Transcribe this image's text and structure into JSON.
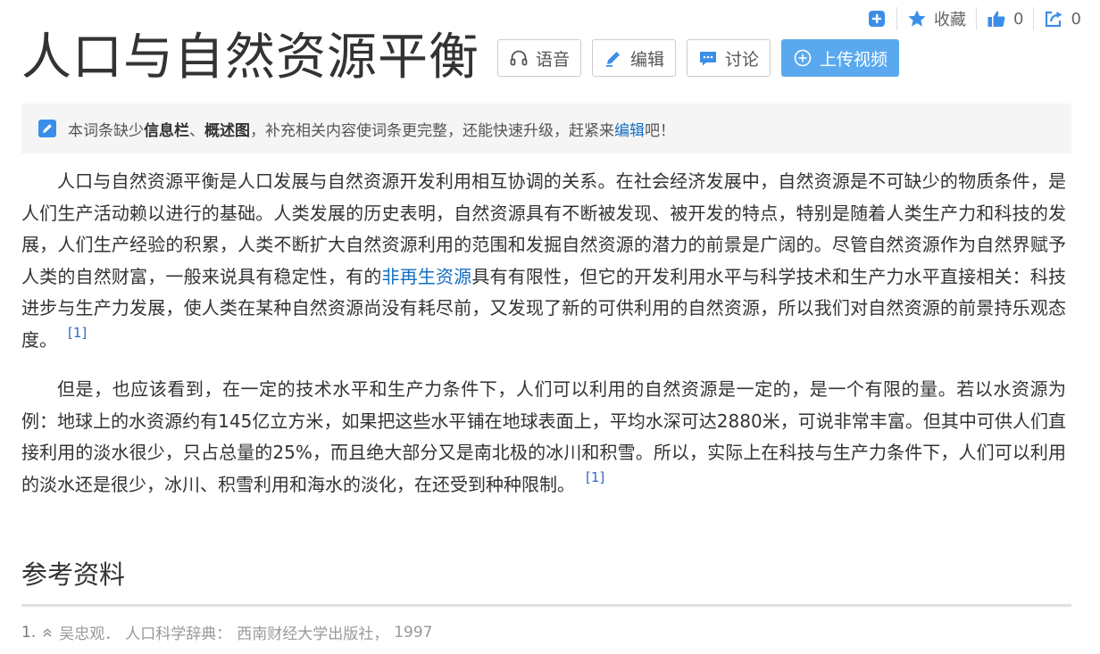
{
  "toolbar": {
    "favorite_label": "收藏",
    "like_count": "0",
    "share_count": "0"
  },
  "title": "人口与自然资源平衡",
  "actions": {
    "voice": "语音",
    "edit": "编辑",
    "discuss": "讨论",
    "upload_video": "上传视频"
  },
  "notice": {
    "prefix": "本词条缺少",
    "item1": "信息栏",
    "sep": "、",
    "item2": "概述图",
    "middle": "，补充相关内容使词条更完整，还能快速升级，赶紧来",
    "link": "编辑",
    "suffix": "吧！"
  },
  "paragraphs": {
    "p1_part1": "人口与自然资源平衡是人口发展与自然资源开发利用相互协调的关系。在社会经济发展中，自然资源是不可缺少的物质条件，是人们生产活动赖以进行的基础。人类发展的历史表明，自然资源具有不断被发现、被开发的特点，特别是随着人类生产力和科技的发展，人们生产经验的积累，人类不断扩大自然资源利用的范围和发掘自然资源的潜力的前景是广阔的。尽管自然资源作为自然界赋予人类的自然财富，一般来说具有稳定性，有的",
    "p1_link": "非再生资源",
    "p1_part2": "具有有限性，但它的开发利用水平与科学技术和生产力水平直接相关：科技进步与生产力发展，使人类在某种自然资源尚没有耗尽前，又发现了新的可供利用的自然资源，所以我们对自然资源的前景持乐观态度。",
    "p1_ref": "[1]",
    "p2_text": "但是，也应该看到，在一定的技术水平和生产力条件下，人们可以利用的自然资源是一定的，是一个有限的量。若以水资源为例：地球上的水资源约有145亿立方米，如果把这些水平铺在地球表面上，平均水深可达2880米，可说非常丰富。但其中可供人们直接利用的淡水很少，只占总量的25%，而且绝大部分又是南北极的冰川和积雪。所以，实际上在科技与生产力条件下，人们可以利用的淡水还是很少，冰川、积雪利用和海水的淡化，在还受到种种限制。",
    "p2_ref": "[1]"
  },
  "references": {
    "heading": "参考资料",
    "items": [
      {
        "num": "1.",
        "author": "吴忠观．",
        "title": "人口科学辞典：",
        "publisher": "西南财经大学出版社，",
        "year": "1997"
      }
    ]
  },
  "colors": {
    "link": "#136ec2",
    "primary_button": "#5aa9ee",
    "toolbar_icon": "#3b8ee8",
    "notice_bg": "#f5f5f5"
  },
  "icons": [
    "add-icon",
    "star-icon",
    "thumbs-up-icon",
    "share-icon",
    "headphones-icon",
    "pencil-icon",
    "chat-icon",
    "plus-circle-icon",
    "edit-notice-icon",
    "caret-up-icon"
  ]
}
